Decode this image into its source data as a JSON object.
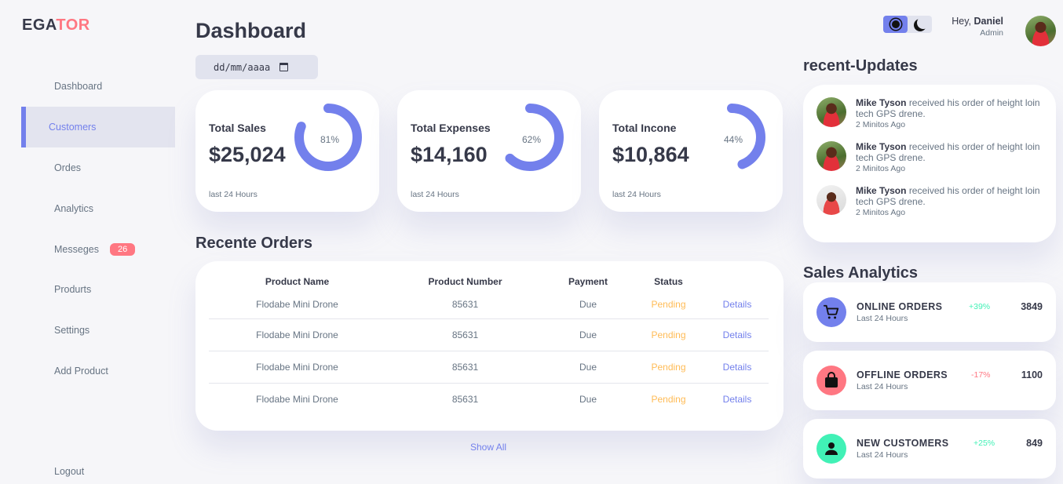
{
  "logo": {
    "part1": "EGA",
    "part2": "TOR"
  },
  "sidebar": {
    "items": [
      {
        "label": "Dashboard"
      },
      {
        "label": "Customers"
      },
      {
        "label": "Ordes"
      },
      {
        "label": "Analytics"
      },
      {
        "label": "Messeges",
        "badge": "26"
      },
      {
        "label": "Produrts"
      },
      {
        "label": "Settings"
      },
      {
        "label": "Add Product"
      },
      {
        "label": "Logout"
      }
    ],
    "active_index": 1
  },
  "main": {
    "title": "Dashboard",
    "date_placeholder": "dd/mm/aaaa",
    "cards": [
      {
        "title": "Total Sales",
        "amount": "$25,024",
        "percent": "81%",
        "percent_value": 81,
        "period": "last 24 Hours"
      },
      {
        "title": "Total Expenses",
        "amount": "$14,160",
        "percent": "62%",
        "percent_value": 62,
        "period": "last 24 Hours"
      },
      {
        "title": "Total Incone",
        "amount": "$10,864",
        "percent": "44%",
        "percent_value": 44,
        "period": "last 24 Hours"
      }
    ],
    "orders": {
      "title": "Recente Orders",
      "headers": [
        "Product Name",
        "Product Number",
        "Payment",
        "Status",
        ""
      ],
      "rows": [
        [
          "Flodabe Mini Drone",
          "85631",
          "Due",
          "Pending",
          "Details"
        ],
        [
          "Flodabe Mini Drone",
          "85631",
          "Due",
          "Pending",
          "Details"
        ],
        [
          "Flodabe Mini Drone",
          "85631",
          "Due",
          "Pending",
          "Details"
        ],
        [
          "Flodabe Mini Drone",
          "85631",
          "Due",
          "Pending",
          "Details"
        ]
      ],
      "show_all": "Show All"
    }
  },
  "header": {
    "greeting": "Hey,",
    "user_name": "Daniel",
    "role": "Admin",
    "theme_active": "light"
  },
  "updates": {
    "title": "recent-Updates",
    "items": [
      {
        "name": "Mike Tyson",
        "text": "received his order of height loin tech GPS drene.",
        "time": "2 Minitos Ago"
      },
      {
        "name": "Mike Tyson",
        "text": "received his order of height loin tech GPS drene.",
        "time": "2 Minitos Ago"
      },
      {
        "name": "Mike Tyson",
        "text": "received his order of height loin tech GPS drene.",
        "time": "2 Minitos Ago"
      }
    ]
  },
  "analytics": {
    "title": "Sales Analytics",
    "items": [
      {
        "title": "ONLINE ORDERS",
        "sub": "Last 24 Hours",
        "change": "+39%",
        "value": "3849",
        "icon": "cart-icon",
        "color": "#7380ec",
        "change_color": "#41f1b6"
      },
      {
        "title": "OFFLINE ORDERS",
        "sub": "Last 24 Hours",
        "change": "-17%",
        "value": "1100",
        "icon": "shopping-bag-icon",
        "color": "#ff7782",
        "change_color": "#ff7782"
      },
      {
        "title": "NEW CUSTOMERS",
        "sub": "Last 24 Hours",
        "change": "+25%",
        "value": "849",
        "icon": "person-icon",
        "color": "#41f1b6",
        "change_color": "#41f1b6"
      }
    ]
  },
  "colors": {
    "primary": "#7380ec",
    "danger": "#ff7782",
    "success": "#41f1b6",
    "warning": "#ffbb55"
  }
}
